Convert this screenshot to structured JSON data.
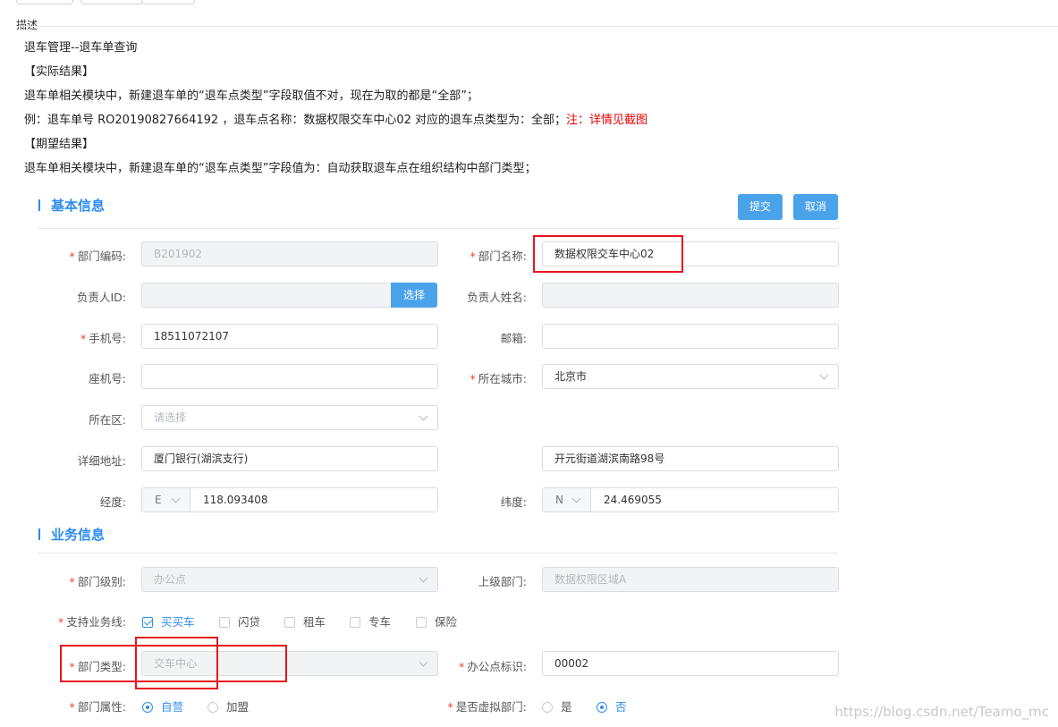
{
  "colors": {
    "accent": "#2d8cf0",
    "button": "#4aa3ea",
    "annotation": "#e8141c",
    "required": "#f04134"
  },
  "description": {
    "header": "描述",
    "lines": [
      "退车管理--退车单查询",
      "【实际结果】",
      "退车单相关模块中，新建退车单的“退车点类型”字段取值不对，现在为取的都是“全部”；",
      "例：退车单号 RO20190827664192 ，退车点名称：数据权限交车中心02  对应的退车点类型为：全部；",
      "【期望结果】",
      "退车单相关模块中，新建退车单的“退车点类型”字段值为：自动获取退车点在组织结构中部门类型；"
    ],
    "note": "注：详情见截图"
  },
  "basic": {
    "title": "基本信息",
    "submit": "提交",
    "cancel": "取消",
    "dept_code_label": "部门编码:",
    "dept_code_value": "B201902",
    "dept_name_label": "部门名称:",
    "dept_name_value": "数据权限交车中心02",
    "manager_id_label": "负责人ID:",
    "select_btn": "选择",
    "manager_name_label": "负责人姓名:",
    "phone_label": "手机号:",
    "phone_value": "18511072107",
    "email_label": "邮箱:",
    "landline_label": "座机号:",
    "city_label": "所在城市:",
    "city_value": "北京市",
    "district_label": "所在区:",
    "district_placeholder": "请选择",
    "address_label": "详细地址:",
    "address_value": "厦门银行(湖滨支行)",
    "address_value2": "开元街道湖滨南路98号",
    "lng_label": "经度:",
    "lng_dir": "E",
    "lng_value": "118.093408",
    "lat_label": "纬度:",
    "lat_dir": "N",
    "lat_value": "24.469055"
  },
  "business": {
    "title": "业务信息",
    "level_label": "部门级别:",
    "level_value": "办公点",
    "parent_label": "上级部门:",
    "parent_value": "数据权限区域A",
    "biz_label": "支持业务线:",
    "biz_options": [
      "买买车",
      "闪贷",
      "租车",
      "专车",
      "保险"
    ],
    "type_label": "部门类型:",
    "type_value": "交车中心",
    "office_label": "办公点标识:",
    "office_value": "00002",
    "attr_label": "部门属性:",
    "attr_options": [
      "自营",
      "加盟"
    ],
    "virtual_label": "是否虚拟部门:",
    "virtual_options": [
      "是",
      "否"
    ]
  },
  "watermark": "https://blog.csdn.net/Teamo_mc"
}
